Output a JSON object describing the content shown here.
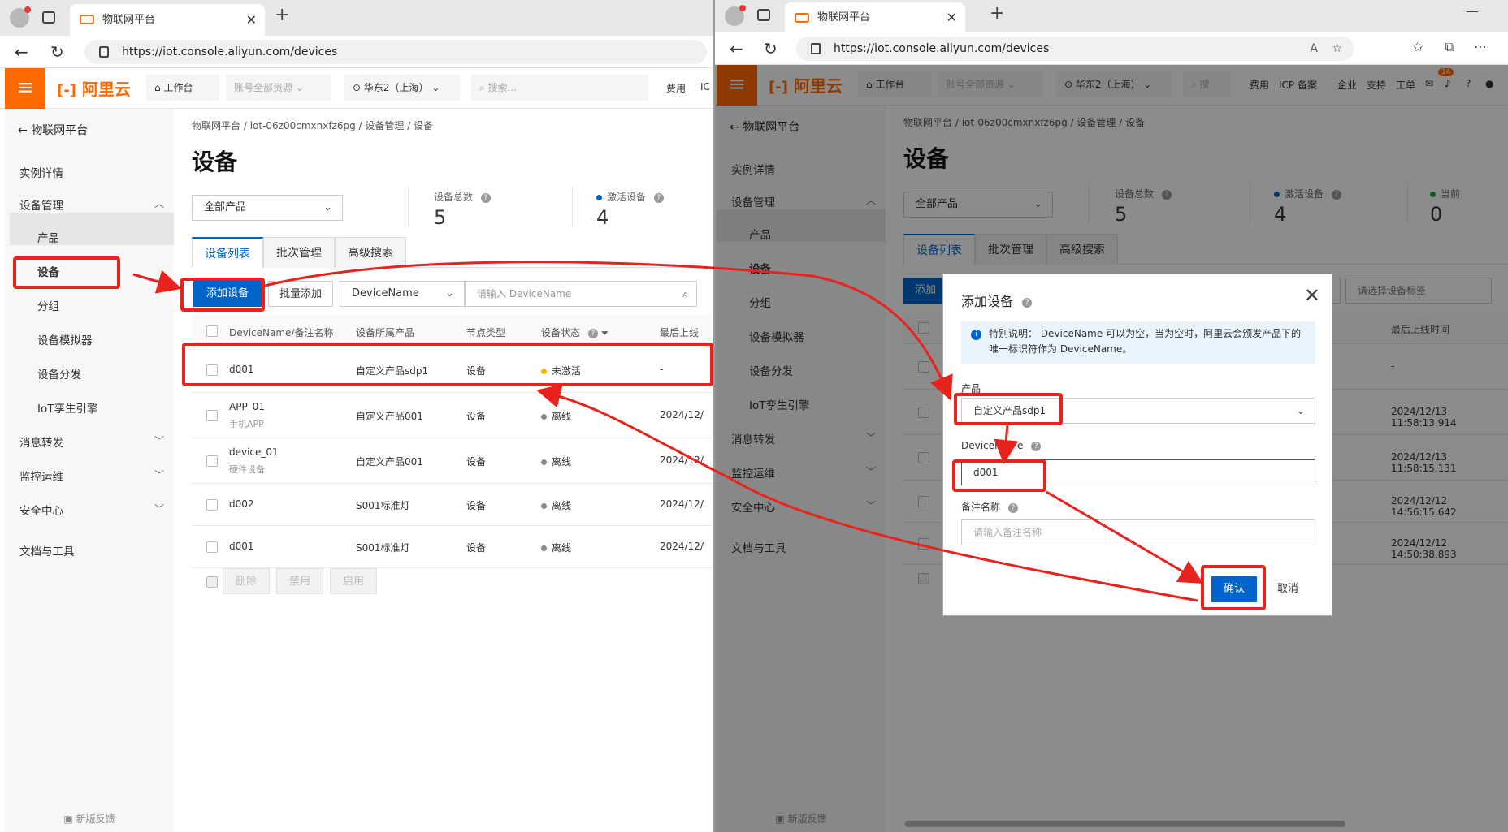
{
  "browser": {
    "tab_title": "物联网平台",
    "url": "https://iot.console.aliyun.com/devices"
  },
  "console": {
    "logo": "阿里云",
    "workbench": "工作台",
    "resources": "账号全部资源",
    "region": "华东2（上海）",
    "search_placeholder": "搜索...",
    "search_short": "搜",
    "nav": [
      "费用",
      "ICP 备案",
      "企业",
      "支持",
      "工单"
    ],
    "left_nav_first": "费用",
    "left_nav_cut": "IC",
    "badge": "14"
  },
  "sidebar": {
    "back": "物联网平台",
    "items": [
      {
        "label": "实例详情"
      },
      {
        "label": "设备管理"
      },
      {
        "label": "产品"
      },
      {
        "label": "设备"
      },
      {
        "label": "分组"
      },
      {
        "label": "设备模拟器"
      },
      {
        "label": "设备分发"
      },
      {
        "label": "IoT孪生引擎"
      },
      {
        "label": "消息转发"
      },
      {
        "label": "监控运维"
      },
      {
        "label": "安全中心"
      },
      {
        "label": "文档与工具"
      }
    ],
    "feedback": "新版反馈"
  },
  "page": {
    "breadcrumb": [
      "物联网平台",
      "iot-06z00cmxnxfz6pg",
      "设备管理",
      "设备"
    ],
    "title": "设备",
    "product_filter": "全部产品",
    "stats": {
      "total_label": "设备总数",
      "total": "5",
      "active_label": "激活设备",
      "active": "4",
      "online_label": "当前",
      "online": "0"
    },
    "tabs": [
      "设备列表",
      "批次管理",
      "高级搜索"
    ],
    "toolbar": {
      "add": "添加设备",
      "add_cut": "添加",
      "batch": "批量添加",
      "field": "DeviceName",
      "search_placeholder": "请输入 DeviceName",
      "tag_placeholder": "请选择设备标签"
    },
    "columns": [
      "DeviceName/备注名称",
      "设备所属产品",
      "节点类型",
      "设备状态",
      "最后上线",
      "最后上线时间"
    ],
    "rows": [
      {
        "name": "d001",
        "note": "",
        "product": "自定义产品sdp1",
        "type": "设备",
        "status": "未激活",
        "status_color": "#f5b800",
        "last": "-"
      },
      {
        "name": "APP_01",
        "note": "手机APP",
        "product": "自定义产品001",
        "type": "设备",
        "status": "离线",
        "status_color": "#888888",
        "last": "2024/12/",
        "last_full": "2024/12/13 11:58:13.914"
      },
      {
        "name": "device_01",
        "note": "硬件设备",
        "product": "自定义产品001",
        "type": "设备",
        "status": "离线",
        "status_color": "#888888",
        "last": "2024/12/",
        "last_full": "2024/12/13 11:58:15.131"
      },
      {
        "name": "d002",
        "note": "",
        "product": "S001标准灯",
        "type": "设备",
        "status": "离线",
        "status_color": "#888888",
        "last": "2024/12/",
        "last_full": "2024/12/12 14:56:15.642"
      },
      {
        "name": "d001",
        "note": "",
        "product": "S001标准灯",
        "type": "设备",
        "status": "离线",
        "status_color": "#888888",
        "last": "2024/12/",
        "last_full": "2024/12/12 14:50:38.893"
      }
    ],
    "bulk": [
      "删除",
      "禁用",
      "启用"
    ]
  },
  "modal": {
    "title": "添加设备",
    "note": "特别说明： DeviceName 可以为空，当为空时，阿里云会颁发产品下的唯一标识符作为 DeviceName。",
    "product_label": "产品",
    "product_value": "自定义产品sdp1",
    "name_label": "DeviceName",
    "name_value": "d001",
    "remark_label": "备注名称",
    "remark_placeholder": "请输入备注名称",
    "confirm": "确认",
    "cancel": "取消"
  },
  "colors": {
    "annotation": "#e8221c",
    "primary": "#0064c8",
    "brand": "#ff6a00"
  }
}
